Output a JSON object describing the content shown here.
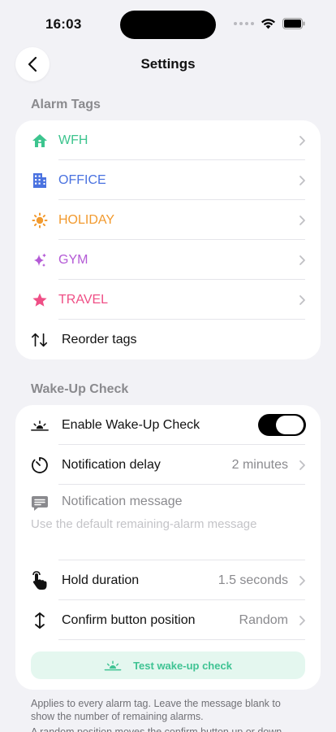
{
  "status": {
    "time": "16:03"
  },
  "nav": {
    "title": "Settings"
  },
  "alarm_tags": {
    "header": "Alarm Tags",
    "tags": [
      {
        "label": "WFH",
        "color": "#3cc48e",
        "icon": "house-icon"
      },
      {
        "label": "OFFICE",
        "color": "#4a72e0",
        "icon": "building-icon"
      },
      {
        "label": "HOLIDAY",
        "color": "#f29a2e",
        "icon": "sun-icon"
      },
      {
        "label": "GYM",
        "color": "#b45ad6",
        "icon": "sparkles-icon"
      },
      {
        "label": "TRAVEL",
        "color": "#ef4f86",
        "icon": "star-icon"
      }
    ],
    "reorder_label": "Reorder tags"
  },
  "wakeup": {
    "header": "Wake-Up Check",
    "enable_label": "Enable Wake-Up Check",
    "enabled": true,
    "delay_label": "Notification delay",
    "delay_value": "2 minutes",
    "message_label": "Notification message",
    "message_placeholder": "Use the default remaining-alarm message",
    "hold_label": "Hold duration",
    "hold_value": "1.5 seconds",
    "position_label": "Confirm button position",
    "position_value": "Random",
    "test_label": "Test wake-up check"
  },
  "footer": {
    "note1": "Applies to every alarm tag. Leave the message blank to show the number of remaining alarms.",
    "note2": "A random position moves the confirm button up or down"
  },
  "colors": {
    "accent_green": "#3fc393",
    "background": "#f2f2f6"
  }
}
